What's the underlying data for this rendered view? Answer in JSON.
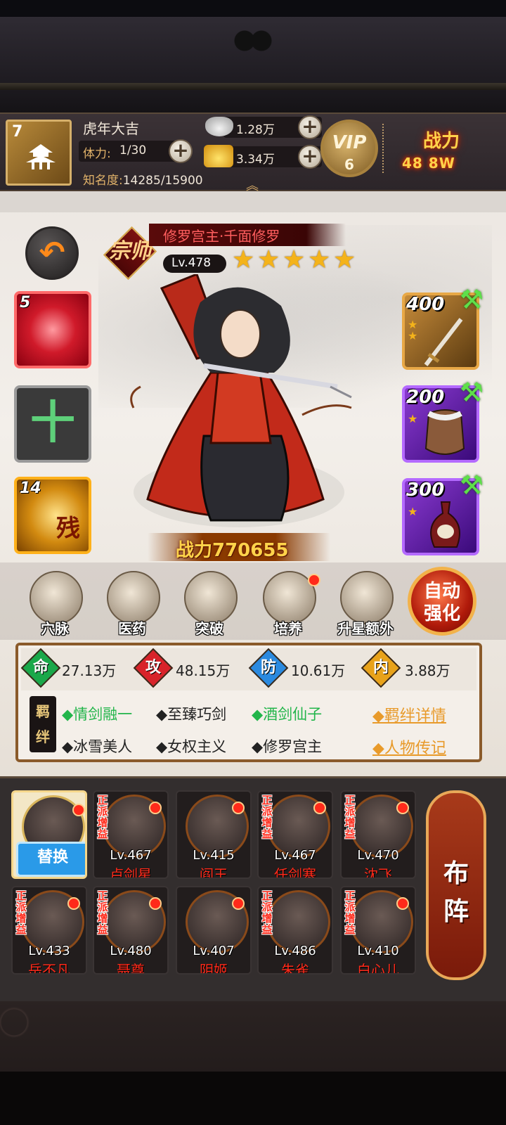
{
  "header": {
    "player_level": "7",
    "player_name": "虎年大吉",
    "stamina_label": "体力:",
    "stamina_value": "1/30",
    "fame_label": "知名度:",
    "fame_value": "14285/15900",
    "silver_value": "1.28万",
    "gold_value": "3.34万",
    "vip_label": "VIP",
    "vip_level": "6",
    "power_label": "战力",
    "power_value": "48  8W"
  },
  "hero": {
    "rank_glyph": "宗师",
    "name": "修罗宫主·千面修罗",
    "level": "Lv.478",
    "stars": 5,
    "total_power": "战力770655"
  },
  "left_slots": [
    {
      "count": "5",
      "kind": "red-orb"
    },
    {
      "count": "",
      "kind": "empty",
      "symbol": "十"
    },
    {
      "count": "14",
      "kind": "gold-relic",
      "mark": "残"
    }
  ],
  "right_slots": [
    {
      "value": "400",
      "stars": 2,
      "item": "sword"
    },
    {
      "value": "200",
      "stars": 1,
      "item": "armor"
    },
    {
      "value": "300",
      "stars": 1,
      "item": "vase"
    }
  ],
  "functions": [
    {
      "label": "穴脉",
      "dot": false
    },
    {
      "label": "医药",
      "dot": false
    },
    {
      "label": "突破",
      "dot": false
    },
    {
      "label": "培养",
      "dot": true
    },
    {
      "label": "升星额外",
      "dot": false
    }
  ],
  "auto_button": "自动强化",
  "stats": [
    {
      "char": "命",
      "value": "27.13万",
      "color": "#1aa84a"
    },
    {
      "char": "攻",
      "value": "48.15万",
      "color": "#d8232a"
    },
    {
      "char": "防",
      "value": "10.61万",
      "color": "#2a8ae0"
    },
    {
      "char": "内",
      "value": "3.88万",
      "color": "#e8a21a"
    }
  ],
  "bonds": {
    "tag": "羁绊",
    "items": [
      {
        "text": "◆情剑融一",
        "active": true
      },
      {
        "text": "◆至臻巧剑",
        "active": false
      },
      {
        "text": "◆酒剑仙子",
        "active": true
      },
      {
        "text": "◆冰雪美人",
        "active": false
      },
      {
        "text": "◆女权主义",
        "active": false
      },
      {
        "text": "◆修罗宫主",
        "active": false
      }
    ],
    "detail_link": "◆羁绊详情",
    "bio_link": "◆人物传记"
  },
  "team": {
    "selected_button": "替换",
    "buff_tag": "正派增益",
    "members": [
      {
        "level": "Lv.467",
        "name": "卢剑星"
      },
      {
        "level": "Lv.415",
        "name": "阎王"
      },
      {
        "level": "Lv.467",
        "name": "任剑寒"
      },
      {
        "level": "Lv.470",
        "name": "沈飞"
      },
      {
        "level": "Lv.433",
        "name": "岳不凡"
      },
      {
        "level": "Lv.480",
        "name": "聂尊"
      },
      {
        "level": "Lv.407",
        "name": "阴姬"
      },
      {
        "level": "Lv.486",
        "name": "朱雀"
      },
      {
        "level": "Lv.410",
        "name": "白心儿"
      }
    ],
    "formation_label": "布阵"
  }
}
